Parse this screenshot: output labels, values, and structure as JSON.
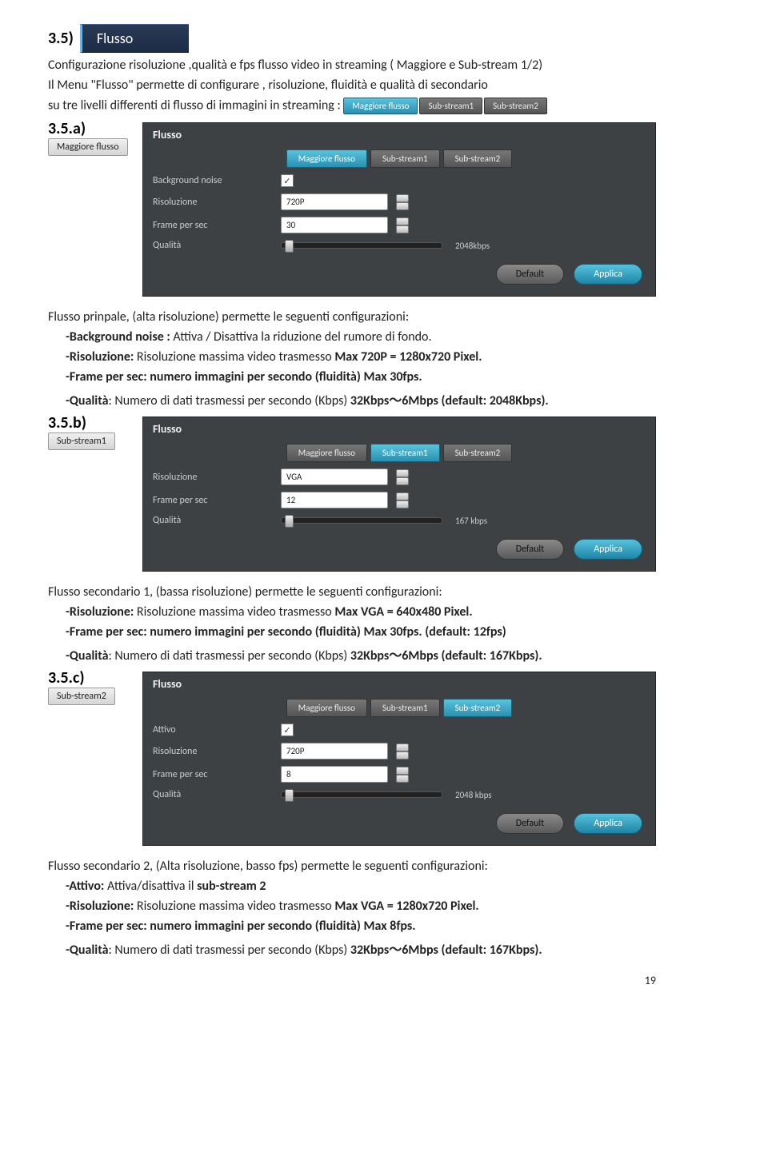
{
  "sec35": {
    "num": "3.5)",
    "nav_label": "Flusso"
  },
  "intro": {
    "line1_before": "Configurazione risoluzione ,qualità e fps flusso video in streaming ( Maggiore e Sub-stream 1/2)",
    "line2_a": "Il Menu \"Flusso\" permette di configurare , risoluzione, fluidità e qualità  di secondario",
    "line3_a": "su tre livelli differenti di flusso di immagini in streaming :",
    "levels": [
      "Maggiore flusso",
      "Sub-stream1",
      "Sub-stream2"
    ]
  },
  "a": {
    "num": "3.5.a)",
    "chip": "Maggiore flusso",
    "panel": {
      "title": "Flusso",
      "tabs": [
        "Maggiore flusso",
        "Sub-stream1",
        "Sub-stream2"
      ],
      "active": 0,
      "rows": [
        {
          "label": "Background noise",
          "type": "check",
          "value": "✓"
        },
        {
          "label": "Risoluzione",
          "type": "select",
          "value": "720P"
        },
        {
          "label": "Frame per sec",
          "type": "select",
          "value": "30"
        },
        {
          "label": "Qualità",
          "type": "slider",
          "value": "2048kbps"
        }
      ],
      "default": "Default",
      "apply": "Applica"
    },
    "desc_title": "Flusso prinpale, (alta risoluzione)  permette le seguenti configurazioni:",
    "d1_a": "-Background noise :",
    "d1_b": " Attiva / Disattiva la riduzione del rumore di fondo.",
    "d2_a": "-Risoluzione:  ",
    "d2_b": "Risoluzione  massima video trasmesso ",
    "d2_c": "Max 720P = 1280x720 Pixel.",
    "d3_a": "-Frame per sec: numero immagini per secondo (fluidità) Max 30fps.",
    "d4_a": "-Qualità",
    "d4_b": ": Numero di dati trasmessi per secondo (Kbps) ",
    "d4_c": "32Kbps～6Mbps (default: 2048Kbps)."
  },
  "b": {
    "num": "3.5.b)",
    "chip": "Sub-stream1",
    "panel": {
      "title": "Flusso",
      "tabs": [
        "Maggiore flusso",
        "Sub-stream1",
        "Sub-stream2"
      ],
      "active": 1,
      "rows": [
        {
          "label": "Risoluzione",
          "type": "select",
          "value": "VGA"
        },
        {
          "label": "Frame per sec",
          "type": "select",
          "value": "12"
        },
        {
          "label": "Qualità",
          "type": "slider",
          "value": "167 kbps"
        }
      ],
      "default": "Default",
      "apply": "Applica"
    },
    "desc_title": "Flusso secondario 1, (bassa risoluzione)  permette le seguenti configurazioni:",
    "d2_a": "-Risoluzione:  ",
    "d2_b": "Risoluzione  massima video trasmesso ",
    "d2_c": "Max VGA = 640x480 Pixel.",
    "d3_a": "-Frame per sec: numero immagini per secondo (fluidità) Max 30fps.",
    "d3_b": " (default: 12fps)",
    "d4_a": "-Qualità",
    "d4_b": ": Numero di dati trasmessi per secondo (Kbps) ",
    "d4_c": "32Kbps～6Mbps (default: 167Kbps)."
  },
  "c": {
    "num": "3.5.c)",
    "chip": "Sub-stream2",
    "panel": {
      "title": "Flusso",
      "tabs": [
        "Maggiore flusso",
        "Sub-stream1",
        "Sub-stream2"
      ],
      "active": 2,
      "rows": [
        {
          "label": "Attivo",
          "type": "check",
          "value": "✓"
        },
        {
          "label": "Risoluzione",
          "type": "select",
          "value": "720P"
        },
        {
          "label": "Frame per sec",
          "type": "select",
          "value": "8"
        },
        {
          "label": "Qualità",
          "type": "slider",
          "value": "2048 kbps"
        }
      ],
      "default": "Default",
      "apply": "Applica"
    },
    "desc_title": "Flusso secondario 2, (Alta risoluzione, basso fps)  permette le seguenti configurazioni:",
    "d1_a": "-Attivo:",
    "d1_b": " Attiva/disattiva il ",
    "d1_c": "sub-stream 2",
    "d2_a": "-Risoluzione:  ",
    "d2_b": "Risoluzione  massima video trasmesso ",
    "d2_c": "Max VGA = 1280x720 Pixel.",
    "d3_a": "-Frame per sec: numero immagini per secondo (fluidità) Max 8fps.",
    "d4_a": "-Qualità",
    "d4_b": ": Numero di dati trasmessi per secondo (Kbps) ",
    "d4_c": "32Kbps～6Mbps (default: 167Kbps)."
  },
  "page": "19"
}
